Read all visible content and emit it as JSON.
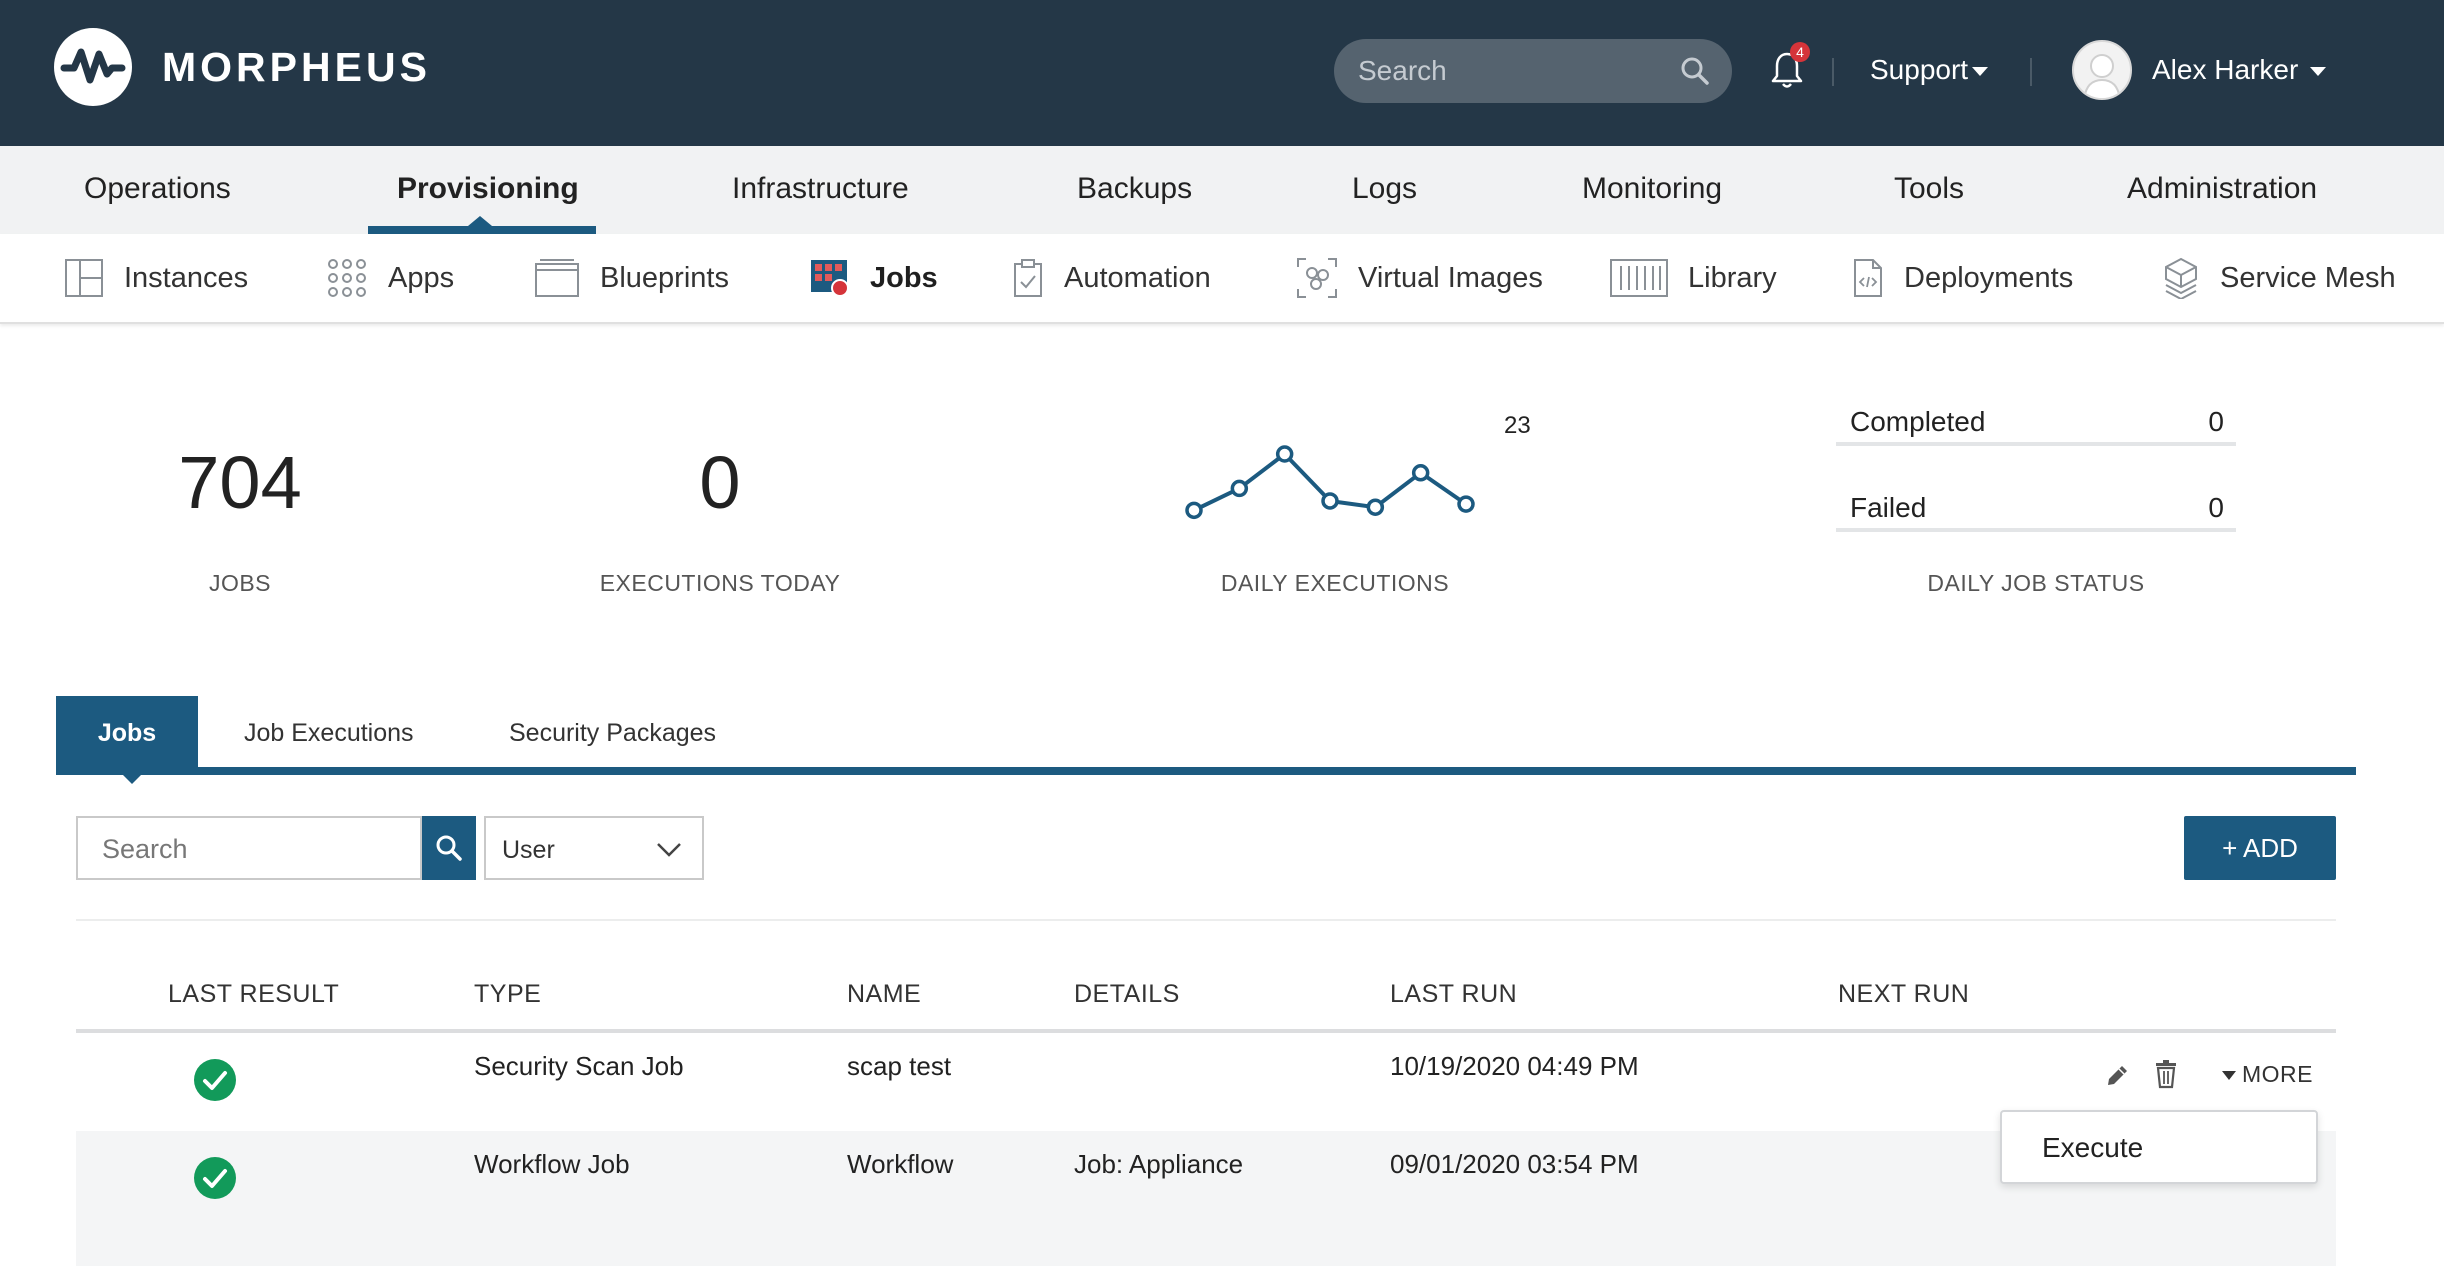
{
  "header": {
    "brand": "MORPHEUS",
    "search_placeholder": "Search",
    "notification_count": "4",
    "support_label": "Support",
    "user_name": "Alex Harker",
    "bg_color": "#243747"
  },
  "main_nav": {
    "items": [
      "Operations",
      "Provisioning",
      "Infrastructure",
      "Backups",
      "Logs",
      "Monitoring",
      "Tools",
      "Administration"
    ],
    "active": "Provisioning"
  },
  "sub_nav": {
    "items": [
      "Instances",
      "Apps",
      "Blueprints",
      "Jobs",
      "Automation",
      "Virtual Images",
      "Library",
      "Deployments",
      "Service Mesh"
    ],
    "active": "Jobs"
  },
  "stats": {
    "jobs_count": "704",
    "jobs_label": "JOBS",
    "executions_today": "0",
    "executions_today_label": "EXECUTIONS TODAY",
    "daily_executions_label": "DAILY EXECUTIONS",
    "daily_executions_peak": "23",
    "daily_executions_series": [
      5,
      12,
      23,
      8,
      6,
      17,
      7
    ],
    "daily_job_status_label": "DAILY JOB STATUS",
    "completed_label": "Completed",
    "completed_value": "0",
    "failed_label": "Failed",
    "failed_value": "0"
  },
  "tabs": {
    "items": [
      "Jobs",
      "Job Executions",
      "Security Packages"
    ],
    "active": "Jobs"
  },
  "toolbar": {
    "search_placeholder": "Search",
    "filter_value": "User",
    "add_label": "+ ADD"
  },
  "table": {
    "columns": [
      "LAST RESULT",
      "TYPE",
      "NAME",
      "DETAILS",
      "LAST RUN",
      "NEXT RUN"
    ],
    "rows": [
      {
        "last_result": "success",
        "type": "Security Scan Job",
        "name": "scap test",
        "details": "",
        "last_run": "10/19/2020 04:49 PM",
        "next_run": ""
      },
      {
        "last_result": "success",
        "type": "Workflow Job",
        "name": "Workflow",
        "details": "Job: Appliance",
        "last_run": "09/01/2020 03:54 PM",
        "next_run": ""
      }
    ],
    "more_label": "MORE",
    "dropdown_items": [
      "Execute"
    ]
  },
  "colors": {
    "accent": "#1c5a80",
    "success": "#129a5a"
  }
}
